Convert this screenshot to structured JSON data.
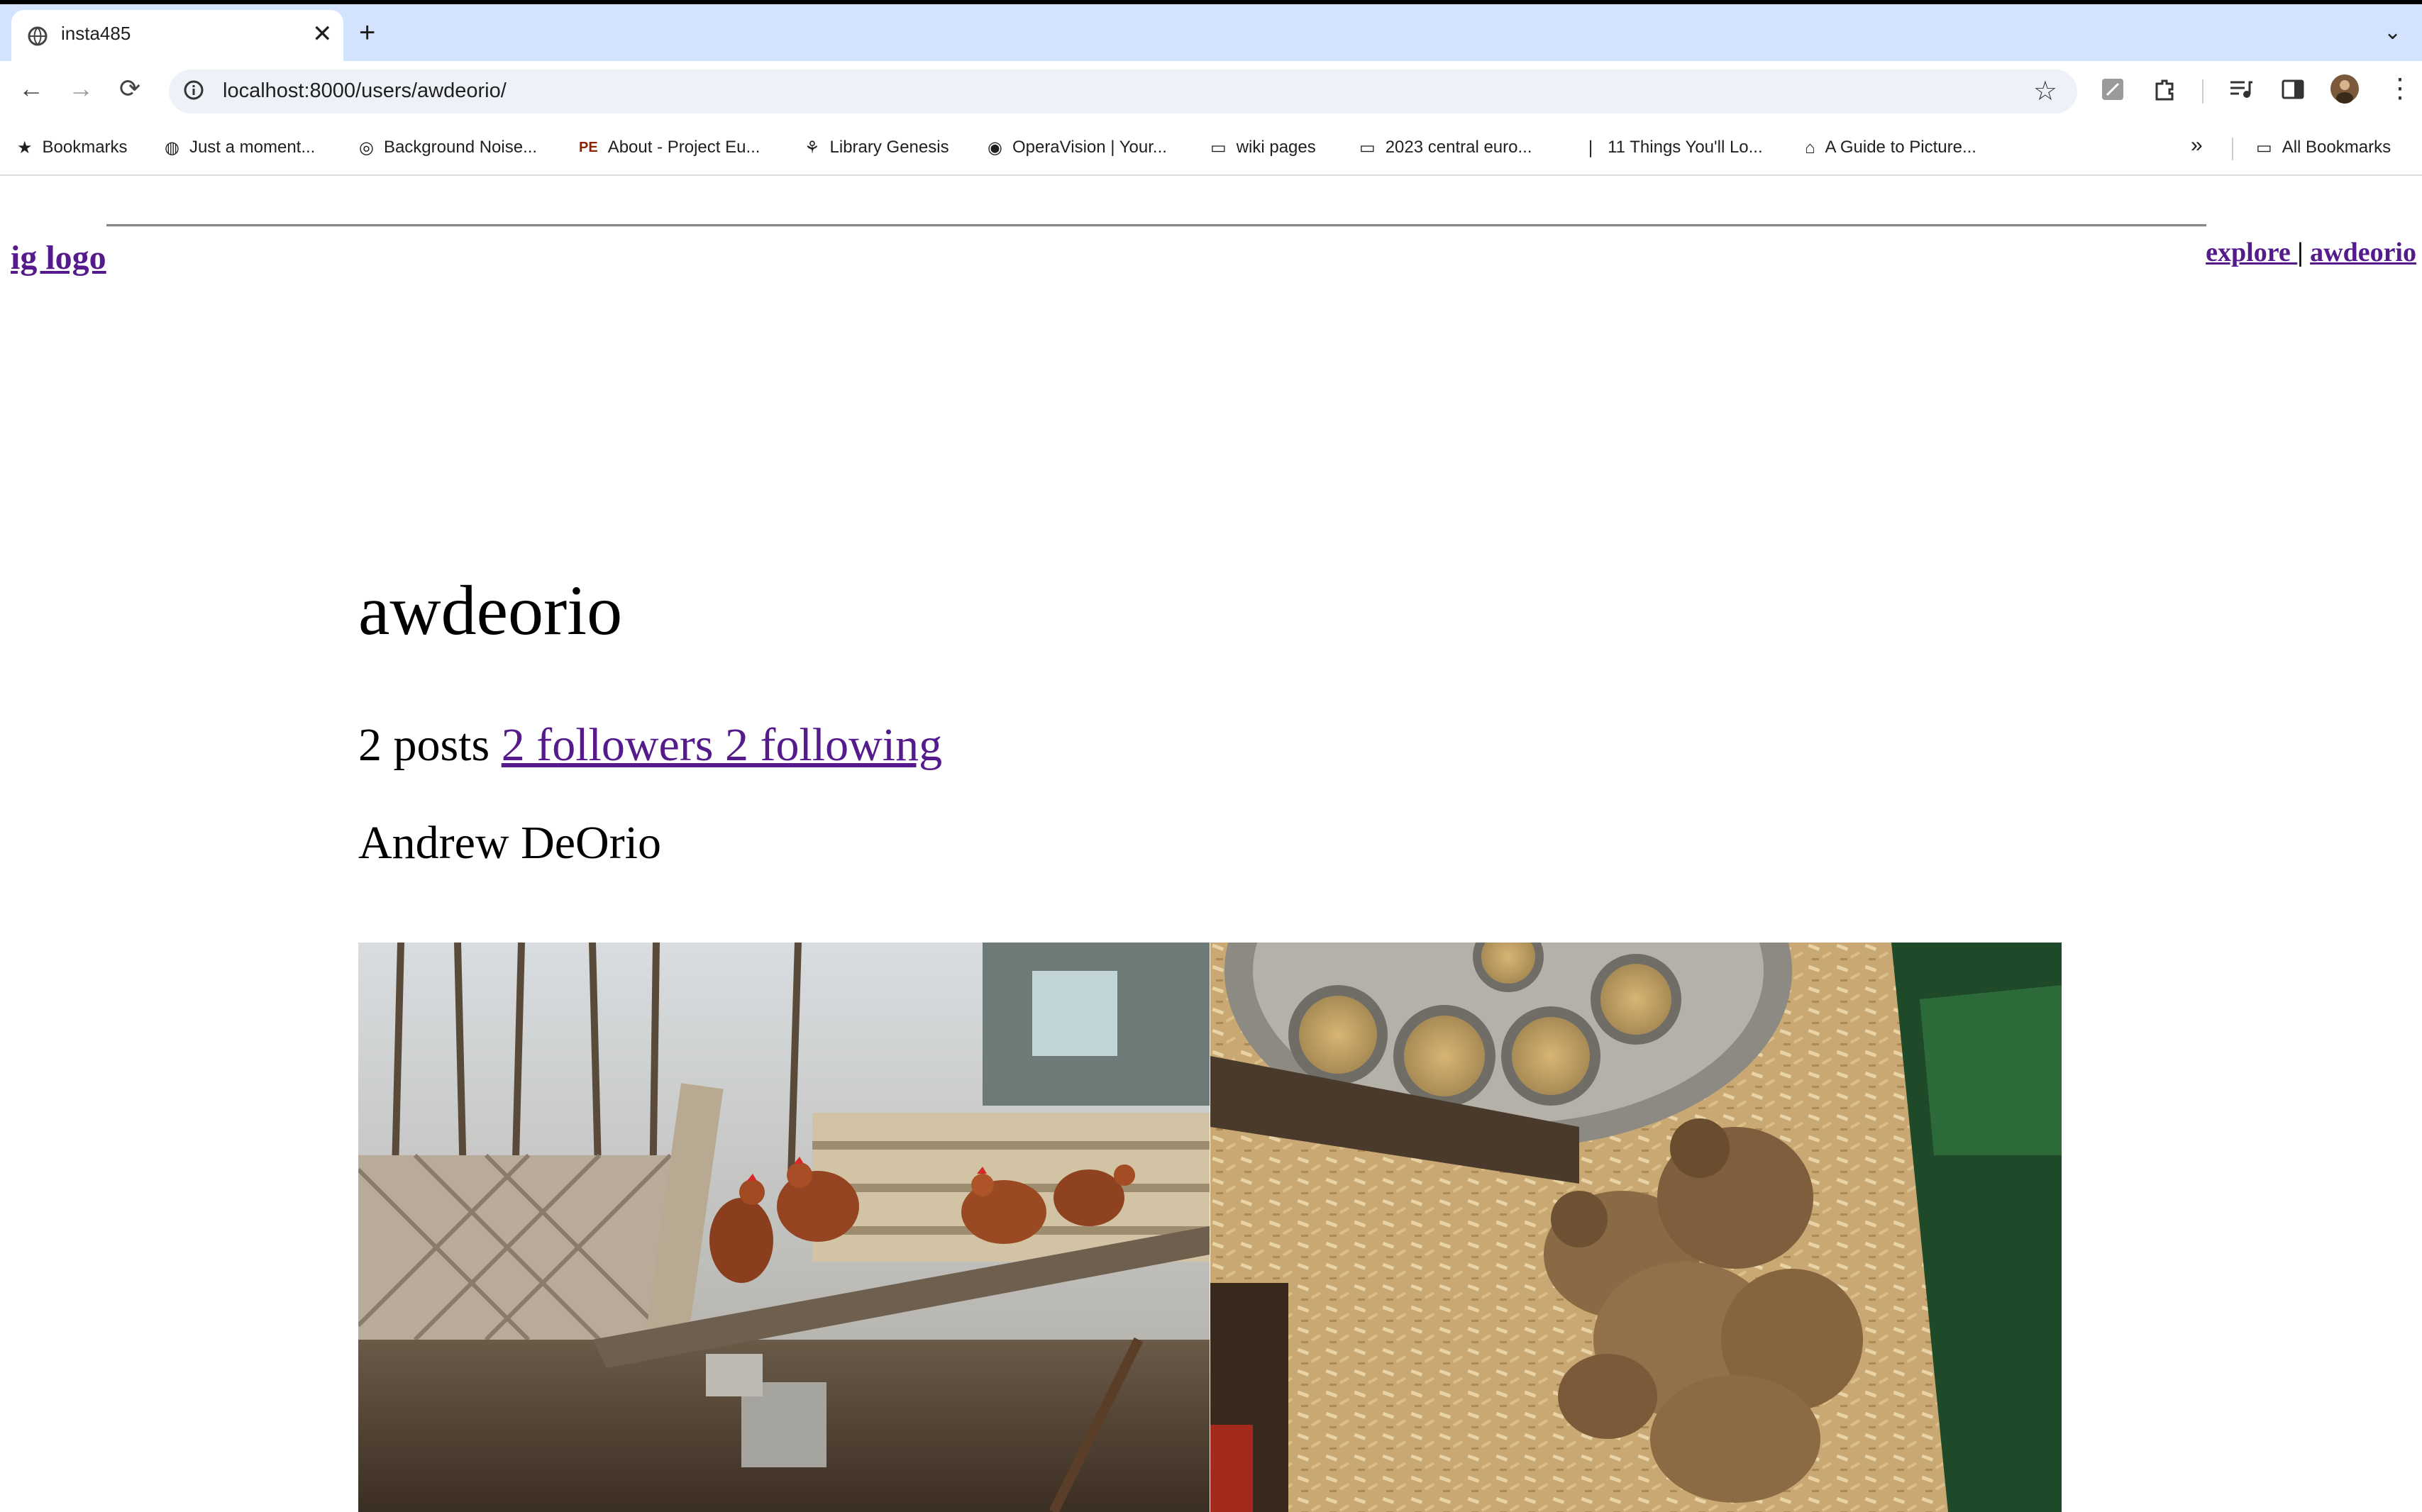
{
  "browser": {
    "tab_title": "insta485",
    "tab_close": "✕",
    "new_tab": "+",
    "tab_search": "⌄",
    "url": "localhost:8000/users/awdeorio/",
    "nav": {
      "back": "←",
      "forward": "→",
      "reload": "⟳"
    },
    "star": "☆",
    "bookmarks": [
      {
        "label": "Bookmarks",
        "icon": "star-icon"
      },
      {
        "label": "Just a moment...",
        "icon": "globe-icon"
      },
      {
        "label": "Background Noise...",
        "icon": "site-icon"
      },
      {
        "label": "About - Project Eu...",
        "icon": "pe-icon"
      },
      {
        "label": "Library Genesis",
        "icon": "site-icon"
      },
      {
        "label": "OperaVision | Your...",
        "icon": "site-icon"
      },
      {
        "label": "wiki pages",
        "icon": "folder-icon"
      },
      {
        "label": "2023 central euro...",
        "icon": "folder-icon"
      },
      {
        "label": "11 Things You'll Lo...",
        "icon": "site-icon"
      },
      {
        "label": "A Guide to Picture...",
        "icon": "site-icon"
      }
    ],
    "bookmarks_overflow": "»",
    "all_bookmarks": "All Bookmarks",
    "pe_badge": "PE"
  },
  "header": {
    "logo": "ig logo",
    "explore": "explore ",
    "separator": "|",
    "user_link": "awdeorio"
  },
  "profile": {
    "username": "awdeorio",
    "posts": "2 posts",
    "followers_following": "2 followers 2 following",
    "full_name": "Andrew DeOrio"
  },
  "colors": {
    "link": "#551a8b",
    "tabstrip": "#d3e3fd",
    "omnibox": "#eef1f8"
  },
  "posts": [
    {
      "subject": "chickens-on-plank-photo"
    },
    {
      "subject": "chicks-in-brooder-photo"
    }
  ]
}
